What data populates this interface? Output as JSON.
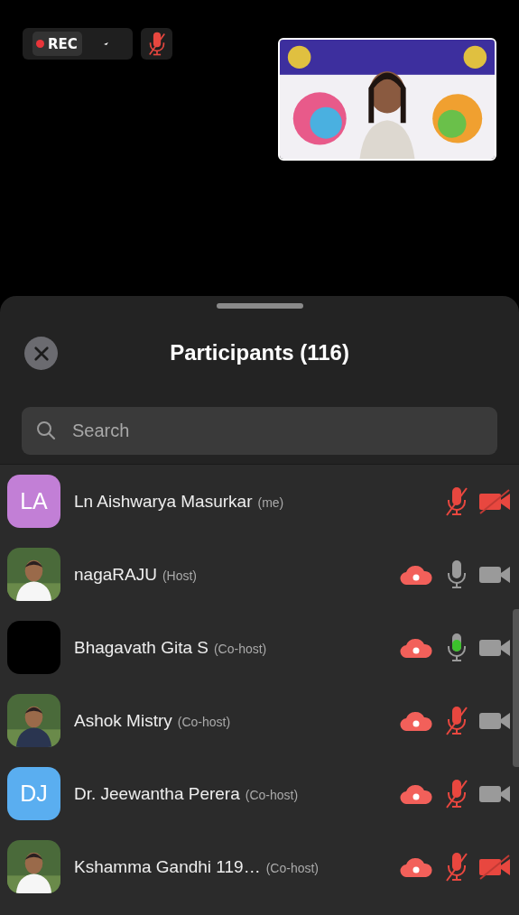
{
  "top_bar": {
    "recording_label": "REC",
    "mic_muted": true
  },
  "sheet": {
    "title": "Participants (116)",
    "search": {
      "placeholder": "Search"
    }
  },
  "participants": [
    {
      "avatar": {
        "kind": "initials",
        "text": "LA",
        "color": "#c27fd6"
      },
      "name": "Ln Aishwarya Masurkar",
      "role": "(me)",
      "recording": false,
      "muted": true,
      "camera_on": false
    },
    {
      "name": "nagaRAJU",
      "role": "(Host)",
      "recording": true,
      "muted": false,
      "speaking": false,
      "camera_on": true
    },
    {
      "avatar": {
        "kind": "blank"
      },
      "name": "Bhagavath Gita S",
      "role": "(Co-host)",
      "recording": true,
      "muted": false,
      "speaking": true,
      "camera_on": true
    },
    {
      "name": "Ashok Mistry",
      "role": "(Co-host)",
      "recording": true,
      "muted": true,
      "camera_on": true
    },
    {
      "avatar": {
        "kind": "initials",
        "text": "DJ",
        "color": "#5aaef0"
      },
      "name": "Dr. Jeewantha Perera",
      "role": "(Co-host)",
      "recording": true,
      "muted": true,
      "camera_on": true
    },
    {
      "name": "Kshamma Gandhi 119…",
      "role": "(Co-host)",
      "recording": true,
      "muted": true,
      "camera_on": false
    }
  ]
}
